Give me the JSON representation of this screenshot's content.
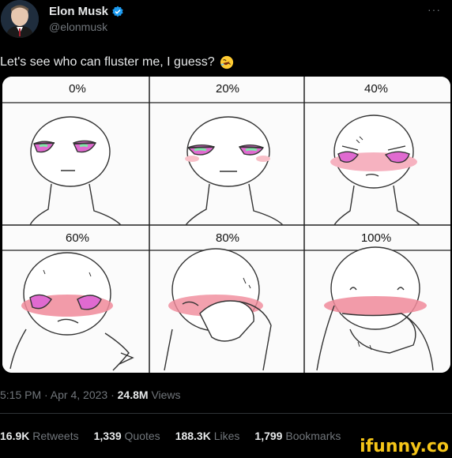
{
  "user": {
    "name": "Elon Musk",
    "handle": "@elonmusk"
  },
  "tweet": {
    "text": "Let's see who can fluster me, I guess?",
    "emoji": "rolling-on-floor-laughing-emoji"
  },
  "meme": {
    "panels": [
      {
        "label": "0%"
      },
      {
        "label": "20%"
      },
      {
        "label": "40%"
      },
      {
        "label": "60%"
      },
      {
        "label": "80%"
      },
      {
        "label": "100%"
      }
    ]
  },
  "meta": {
    "time": "5:15 PM · Apr 4, 2023 ·",
    "views_count": "24.8M",
    "views_label": "Views"
  },
  "stats": {
    "retweets_count": "16.9K",
    "retweets_label": "Retweets",
    "quotes_count": "1,339",
    "quotes_label": "Quotes",
    "likes_count": "188.3K",
    "likes_label": "Likes",
    "bookmarks_count": "1,799",
    "bookmarks_label": "Bookmarks"
  },
  "watermark": "ifunny.co",
  "colors": {
    "background": "#000000",
    "text": "#e7e9ea",
    "muted": "#71767b",
    "verified": "#1d9bf0",
    "blush": "#f08a9a",
    "eye_pink": "#e06ad0",
    "eye_green": "#7fe8a8",
    "watermark": "#f5c518"
  }
}
